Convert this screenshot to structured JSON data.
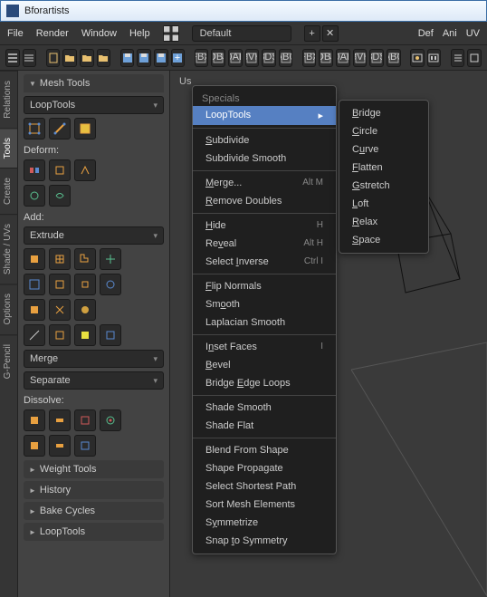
{
  "app": {
    "title": "Bforartists"
  },
  "topmenu": {
    "file": "File",
    "render": "Render",
    "window": "Window",
    "help": "Help",
    "layout": "Default",
    "def": "Def",
    "ani": "Ani",
    "uv": "UV"
  },
  "viewport": {
    "label": "Us"
  },
  "vtabs": {
    "relations": "Relations",
    "tools": "Tools",
    "create": "Create",
    "shade": "Shade / UVs",
    "options": "Options",
    "gpencil": "G-Pencil"
  },
  "sidebar": {
    "mesh_tools": "Mesh Tools",
    "looptools": "LoopTools",
    "deform": "Deform:",
    "add": "Add:",
    "extrude": "Extrude",
    "merge": "Merge",
    "separate": "Separate",
    "dissolve": "Dissolve:",
    "weight_tools": "Weight Tools",
    "history": "History",
    "bake_cycles": "Bake Cycles",
    "looptools_panel": "LoopTools"
  },
  "specials": {
    "title": "Specials",
    "items": {
      "looptools": "LoopTools",
      "subdivide": "Subdivide",
      "subdivide_smooth": "Subdivide Smooth",
      "merge": "Merge...",
      "remove_doubles": "Remove Doubles",
      "hide": "Hide",
      "reveal": "Reveal",
      "select_inverse": "Select Inverse",
      "flip_normals": "Flip Normals",
      "smooth": "Smooth",
      "laplacian": "Laplacian Smooth",
      "inset": "Inset Faces",
      "bevel": "Bevel",
      "bridge_edge": "Bridge Edge Loops",
      "shade_smooth": "Shade Smooth",
      "shade_flat": "Shade Flat",
      "blend_shape": "Blend From Shape",
      "shape_prop": "Shape Propagate",
      "shortest": "Select Shortest Path",
      "sort": "Sort Mesh Elements",
      "symmetrize": "Symmetrize",
      "snap_sym": "Snap to Symmetry"
    },
    "sc": {
      "merge": "Alt M",
      "hide": "H",
      "reveal": "Alt H",
      "inverse": "Ctrl I",
      "inset": "I"
    }
  },
  "submenu": {
    "bridge": "Bridge",
    "circle": "Circle",
    "curve": "Curve",
    "flatten": "Flatten",
    "gstretch": "Gstretch",
    "loft": "Loft",
    "relax": "Relax",
    "space": "Space"
  }
}
